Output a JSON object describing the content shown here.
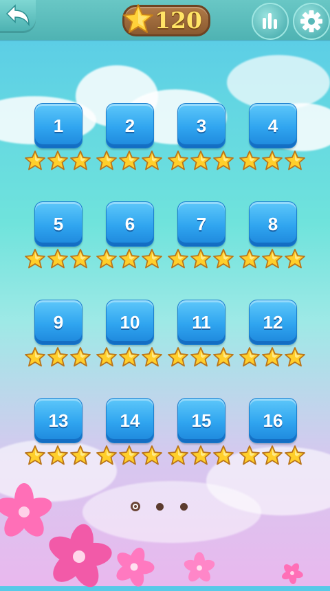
{
  "header": {
    "coin_count": "120"
  },
  "levels": [
    {
      "number": "1",
      "stars": 3
    },
    {
      "number": "2",
      "stars": 3
    },
    {
      "number": "3",
      "stars": 3
    },
    {
      "number": "4",
      "stars": 3
    },
    {
      "number": "5",
      "stars": 3
    },
    {
      "number": "6",
      "stars": 3
    },
    {
      "number": "7",
      "stars": 3
    },
    {
      "number": "8",
      "stars": 3
    },
    {
      "number": "9",
      "stars": 3
    },
    {
      "number": "10",
      "stars": 3
    },
    {
      "number": "11",
      "stars": 3
    },
    {
      "number": "12",
      "stars": 3
    },
    {
      "number": "13",
      "stars": 3
    },
    {
      "number": "14",
      "stars": 3
    },
    {
      "number": "15",
      "stars": 3
    },
    {
      "number": "16",
      "stars": 3
    }
  ],
  "pager": {
    "pages": 3,
    "active": 1
  },
  "icons": {
    "back": "back-arrow-icon",
    "coin": "star-icon",
    "stats": "leaderboard-icon",
    "settings": "gear-icon"
  },
  "colors": {
    "level_button": "#2fa4ef",
    "star": "#ffcf2a",
    "topbar": "#58b8b8"
  }
}
